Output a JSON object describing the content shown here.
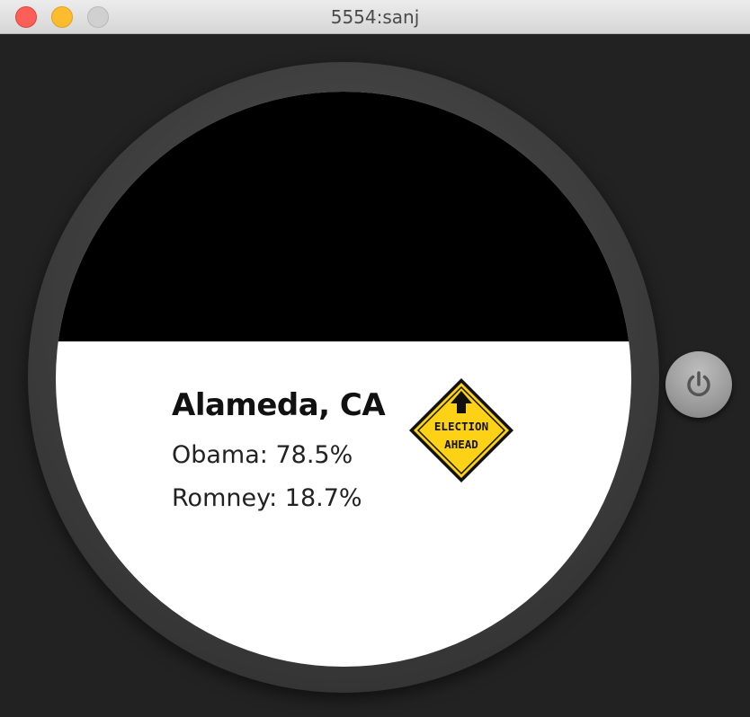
{
  "window": {
    "title": "5554:sanj"
  },
  "watch": {
    "location": "Alameda, CA",
    "results": [
      {
        "candidate": "Obama",
        "text": "Obama: 78.5%"
      },
      {
        "candidate": "Romney",
        "text": "Romney: 18.7%"
      }
    ],
    "sign": {
      "line1": "ELECTION",
      "line2": "AHEAD",
      "icon": "election-ahead-sign-icon"
    }
  },
  "controls": {
    "power_icon": "power-icon"
  },
  "colors": {
    "screen_top": "#000000",
    "screen_bottom": "#ffffff",
    "sign_fill": "#fcd116",
    "sign_border": "#111111"
  }
}
